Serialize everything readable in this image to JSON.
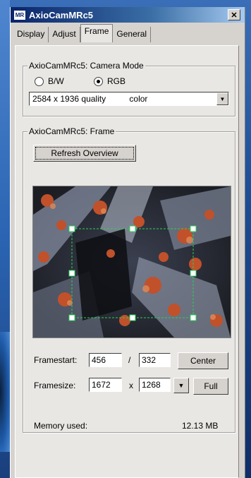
{
  "window": {
    "title": "AxioCamMRc5",
    "icon_text": "MR",
    "close_glyph": "✕"
  },
  "tabs": [
    {
      "label": "Display"
    },
    {
      "label": "Adjust"
    },
    {
      "label": "Frame",
      "active": true
    },
    {
      "label": "General"
    }
  ],
  "camera_mode": {
    "group_label": "AxioCamMRc5: Camera Mode",
    "options": [
      {
        "label": "B/W",
        "selected": false
      },
      {
        "label": "RGB",
        "selected": true
      }
    ],
    "quality_select": {
      "value": "2584 x 1936 quality          color"
    }
  },
  "frame": {
    "group_label": "AxioCamMRc5: Frame",
    "refresh_button": "Refresh Overview",
    "framestart_label": "Framestart:",
    "framestart_x": "456",
    "framestart_sep": "/",
    "framestart_y": "332",
    "center_button": "Center",
    "framesize_label": "Framesize:",
    "framesize_w": "1672",
    "framesize_sep": "x",
    "framesize_h": "1268",
    "full_button": "Full",
    "memory_label": "Memory used:",
    "memory_value": "12.13  MB"
  },
  "colors": {
    "selection_green": "#2ad05a",
    "title_blue": "#0a246a"
  }
}
